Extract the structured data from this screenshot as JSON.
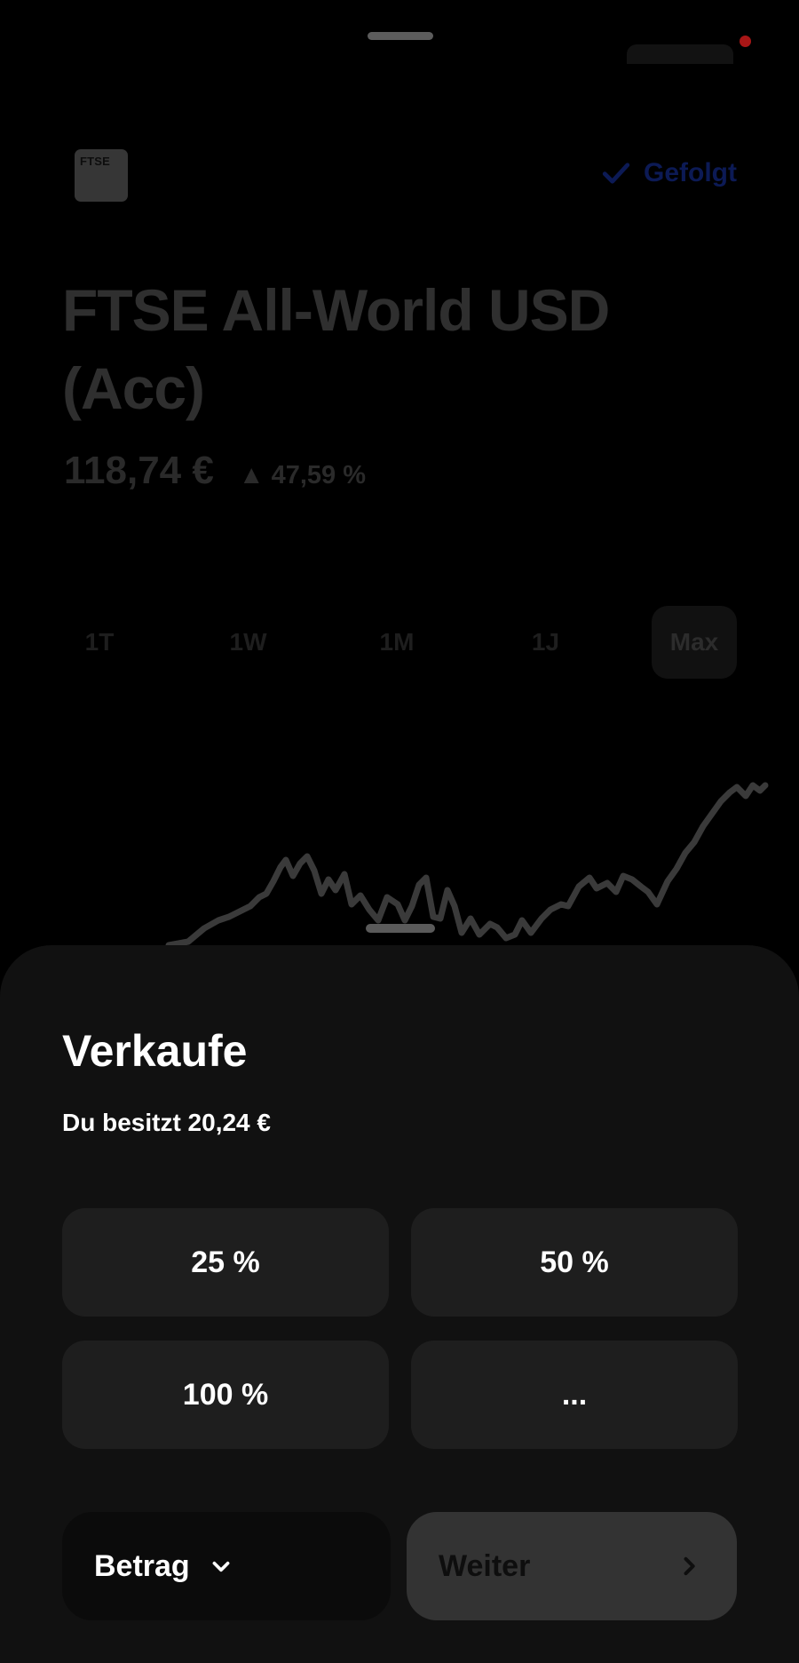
{
  "background": {
    "logo_text": "FTSE",
    "follow_label": "Gefolgt",
    "title_line1": "FTSE All-World USD",
    "title_line2": "(Acc)",
    "price": "118,74 €",
    "change": "▲ 47,59 %",
    "ranges": [
      "1T",
      "1W",
      "1M",
      "1J",
      "Max"
    ],
    "active_range": "Max"
  },
  "sheet": {
    "title": "Verkaufe",
    "subtitle": "Du besitzt 20,24 €",
    "options": [
      "25 %",
      "50 %",
      "100 %",
      "..."
    ],
    "amount_mode_label": "Betrag",
    "next_label": "Weiter"
  },
  "colors": {
    "accent_follow": "#0c1a55",
    "sheet_bg": "#111111",
    "option_bg": "#1e1e1e"
  },
  "icons": {
    "follow": "check-icon",
    "betrag": "chevron-down-icon",
    "weiter": "chevron-right-icon"
  }
}
